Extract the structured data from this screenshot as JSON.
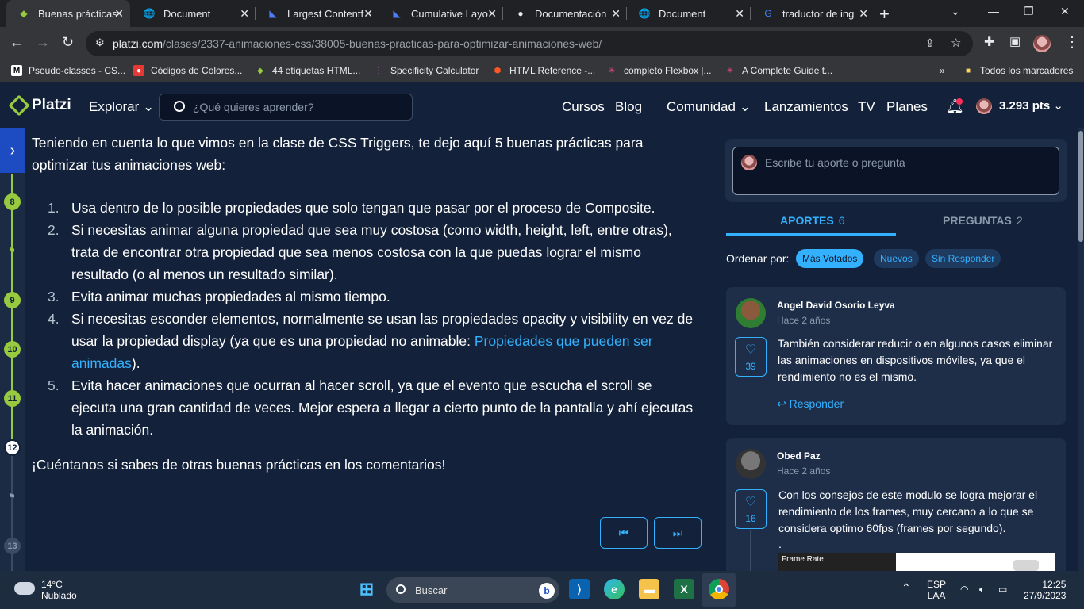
{
  "browser": {
    "tabs": [
      {
        "title": "Buenas prácticas",
        "active": true
      },
      {
        "title": "Document"
      },
      {
        "title": "Largest Contentf"
      },
      {
        "title": "Cumulative Layo"
      },
      {
        "title": "Documentación"
      },
      {
        "title": "Document"
      },
      {
        "title": "traductor de ing"
      }
    ],
    "url_domain": "platzi.com",
    "url_path": "/clases/2337-animaciones-css/38005-buenas-practicas-para-optimizar-animaciones-web/",
    "bookmarks": [
      {
        "label": "Pseudo-classes - CS..."
      },
      {
        "label": "Códigos de Colores..."
      },
      {
        "label": "44 etiquetas HTML..."
      },
      {
        "label": "Specificity Calculator"
      },
      {
        "label": "HTML Reference -..."
      },
      {
        "label": "completo Flexbox |..."
      },
      {
        "label": "A Complete Guide t..."
      }
    ],
    "bookmarks_overflow": "»",
    "all_bookmarks": "Todos los marcadores"
  },
  "header": {
    "logo": "Platzi",
    "explore": "Explorar",
    "search_placeholder": "¿Qué quieres aprender?",
    "nav": [
      "Cursos",
      "Blog",
      "Comunidad",
      "Lanzamientos",
      "TV",
      "Planes"
    ],
    "points": "3.293 pts"
  },
  "progress": {
    "nodes": [
      "8",
      "9",
      "10",
      "11",
      "12",
      "13"
    ]
  },
  "article": {
    "intro": "Teniendo en cuenta lo que vimos en la clase de CSS Triggers, te dejo aquí 5 buenas prácticas para optimizar tus animaciones web:",
    "items": [
      {
        "num": "1.",
        "text": "Usa dentro de lo posible propiedades que solo tengan que pasar por el proceso de Composite."
      },
      {
        "num": "2.",
        "text": "Si necesitas animar alguna propiedad que sea muy costosa (como width, height, left, entre otras), trata de encontrar otra propiedad que sea menos costosa con la que puedas lograr el mismo resultado (o al menos un resultado similar)."
      },
      {
        "num": "3.",
        "text": "Evita animar muchas propiedades al mismo tiempo."
      },
      {
        "num": "4.",
        "text_before": "Si necesitas esconder elementos, normalmente se usan las propiedades opacity y visibility en vez de usar la propiedad display (ya que es una propiedad no animable: ",
        "link": "Propiedades que pueden ser animadas",
        "text_after": ")."
      },
      {
        "num": "5.",
        "text": "Evita hacer animaciones que ocurran al hacer scroll, ya que el evento que escucha el scroll se ejecuta una gran cantidad de veces. Mejor espera a llegar a cierto punto de la pantalla y ahí ejecutas la animación."
      }
    ],
    "outro": "¡Cuéntanos si sabes de otras buenas prácticas en los comentarios!"
  },
  "sidebar": {
    "ask_placeholder": "Escribe tu aporte o pregunta",
    "tab_aportes": "APORTES",
    "tab_aportes_count": "6",
    "tab_preguntas": "PREGUNTAS",
    "tab_preguntas_count": "2",
    "order_label": "Ordenar por:",
    "chips": [
      "Más Votados",
      "Nuevos",
      "Sin Responder"
    ],
    "comments": [
      {
        "name": "Angel David Osorio Leyva",
        "date": "Hace 2 años",
        "likes": "39",
        "text": "También considerar reducir o en algunos casos eliminar las animaciones en dispositivos móviles, ya que el rendimiento no es el mismo.",
        "reply": "Responder"
      },
      {
        "name": "Obed Paz",
        "date": "Hace 2 años",
        "likes": "16",
        "text": "Con los consejos de este modulo se logra mejorar el rendimiento de los frames, muy cercano a lo que se considera optimo 60fps (frames por segundo).",
        "dot": ".",
        "image_label": "Frame Rate"
      }
    ]
  },
  "taskbar": {
    "temp": "14°C",
    "weather": "Nublado",
    "search": "Buscar",
    "lang1": "ESP",
    "lang2": "LAA",
    "time": "12:25",
    "date": "27/9/2023"
  }
}
